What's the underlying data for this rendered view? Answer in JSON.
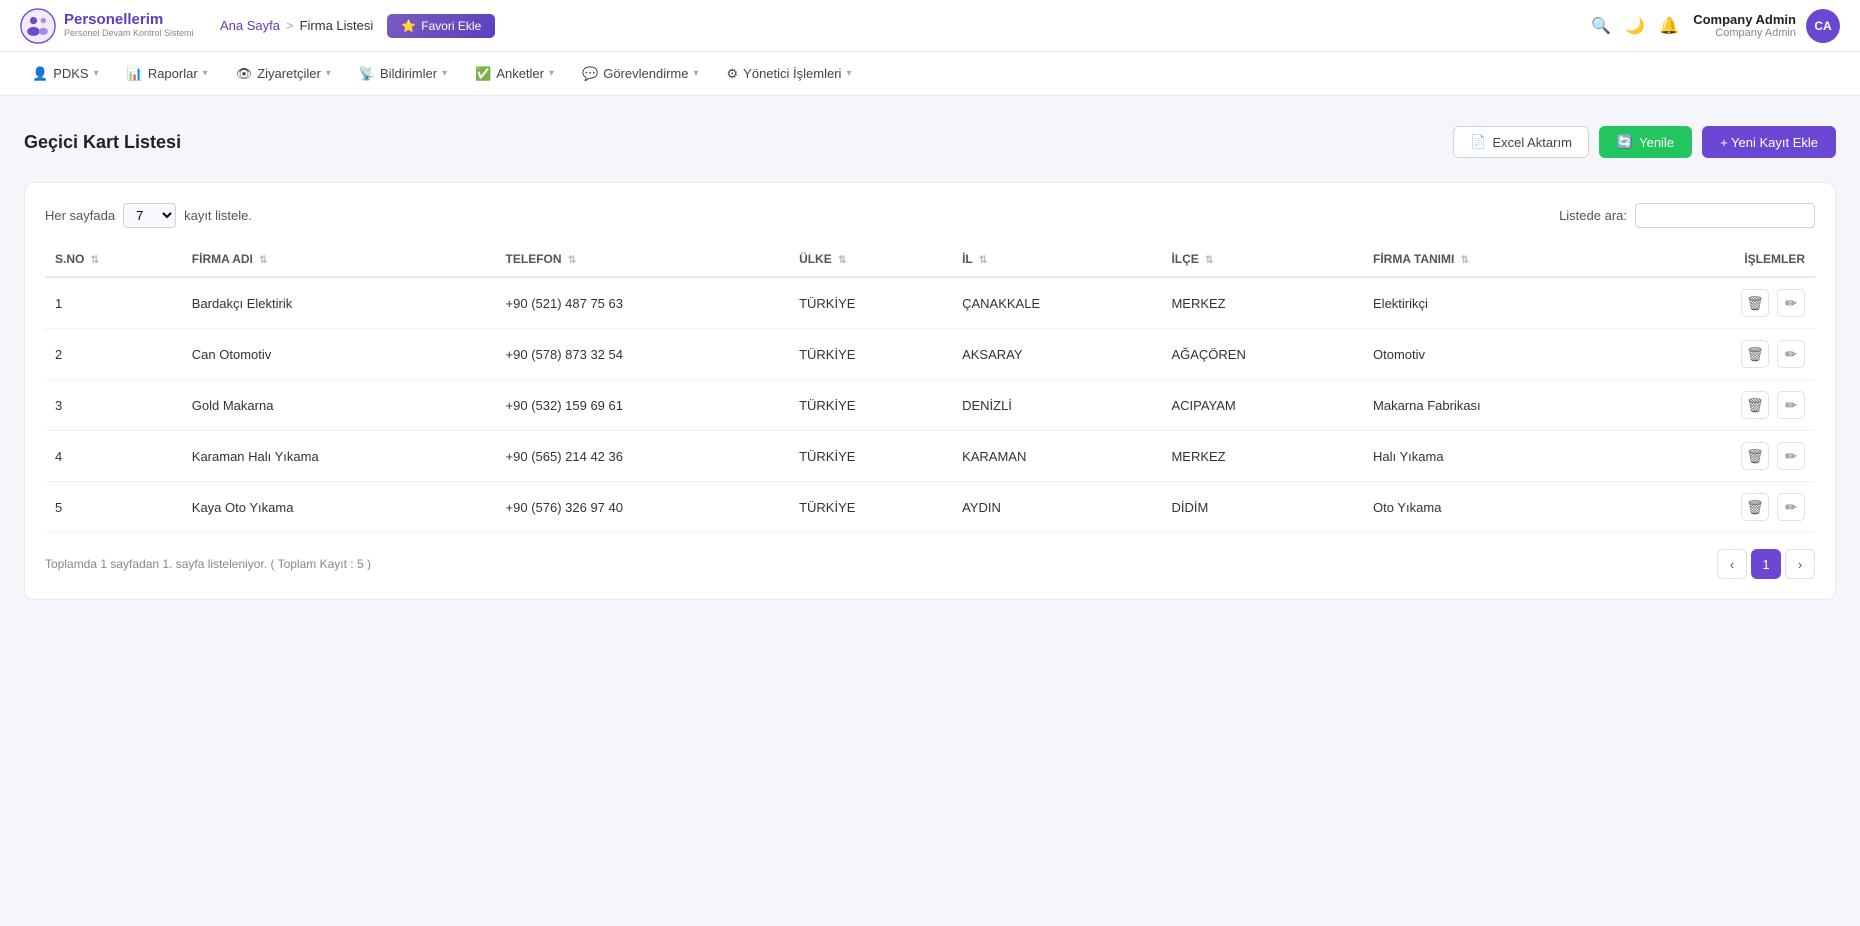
{
  "app": {
    "logo_main": "Personellerim",
    "logo_sub": "Personel Devam Kontrol Sistemi"
  },
  "breadcrumb": {
    "home": "Ana Sayfa",
    "separator": ">",
    "current": "Firma Listesi"
  },
  "favori_btn": "Favori Ekle",
  "topbar": {
    "user_name": "Company Admin",
    "user_role": "Company Admin",
    "avatar_initials": "CA"
  },
  "nav": {
    "items": [
      {
        "label": "PDKS",
        "icon": "👤"
      },
      {
        "label": "Raporlar",
        "icon": "📊"
      },
      {
        "label": "Ziyaretçiler",
        "icon": "👁"
      },
      {
        "label": "Bildirimler",
        "icon": "📡"
      },
      {
        "label": "Anketler",
        "icon": "✅"
      },
      {
        "label": "Görevlendirme",
        "icon": "💬"
      },
      {
        "label": "Yönetici İşlemleri",
        "icon": "⚙"
      }
    ]
  },
  "page": {
    "title": "Geçici Kart Listesi",
    "btn_excel": "Excel Aktarım",
    "btn_refresh": "Yenile",
    "btn_add": "+ Yeni Kayıt Ekle"
  },
  "table_controls": {
    "per_page_label": "Her sayfada",
    "per_page_value": "7",
    "per_page_suffix": "kayıt listele.",
    "search_label": "Listede ara:"
  },
  "table": {
    "columns": [
      {
        "key": "sno",
        "label": "S.NO"
      },
      {
        "key": "firma_adi",
        "label": "FİRMA ADI"
      },
      {
        "key": "telefon",
        "label": "TELEFON"
      },
      {
        "key": "ulke",
        "label": "ÜLKE"
      },
      {
        "key": "il",
        "label": "İL"
      },
      {
        "key": "ilce",
        "label": "İLÇE"
      },
      {
        "key": "firma_tanimi",
        "label": "FİRMA TANIMI"
      },
      {
        "key": "islemler",
        "label": "İŞLEMLER"
      }
    ],
    "rows": [
      {
        "sno": "1",
        "firma_adi": "Bardakçı Elektirik",
        "telefon": "+90 (521) 487 75 63",
        "ulke": "TÜRKİYE",
        "il": "ÇANAKKALE",
        "ilce": "MERKEZ",
        "firma_tanimi": "Elektirikçi"
      },
      {
        "sno": "2",
        "firma_adi": "Can Otomotiv",
        "telefon": "+90 (578) 873 32 54",
        "ulke": "TÜRKİYE",
        "il": "AKSARAY",
        "ilce": "AĞAÇÖREN",
        "firma_tanimi": "Otomotiv"
      },
      {
        "sno": "3",
        "firma_adi": "Gold Makarna",
        "telefon": "+90 (532) 159 69 61",
        "ulke": "TÜRKİYE",
        "il": "DENİZLİ",
        "ilce": "ACIPAYAM",
        "firma_tanimi": "Makarna Fabrikası"
      },
      {
        "sno": "4",
        "firma_adi": "Karaman Halı Yıkama",
        "telefon": "+90 (565) 214 42 36",
        "ulke": "TÜRKİYE",
        "il": "KARAMAN",
        "ilce": "MERKEZ",
        "firma_tanimi": "Halı Yıkama"
      },
      {
        "sno": "5",
        "firma_adi": "Kaya Oto Yıkama",
        "telefon": "+90 (576) 326 97 40",
        "ulke": "TÜRKİYE",
        "il": "AYDIN",
        "ilce": "DİDİM",
        "firma_tanimi": "Oto Yıkama"
      }
    ]
  },
  "pagination": {
    "info": "Toplamda 1 sayfadan 1. sayfa listeleniyor. ( Toplam Kayıt : 5 )",
    "current_page": "1"
  }
}
